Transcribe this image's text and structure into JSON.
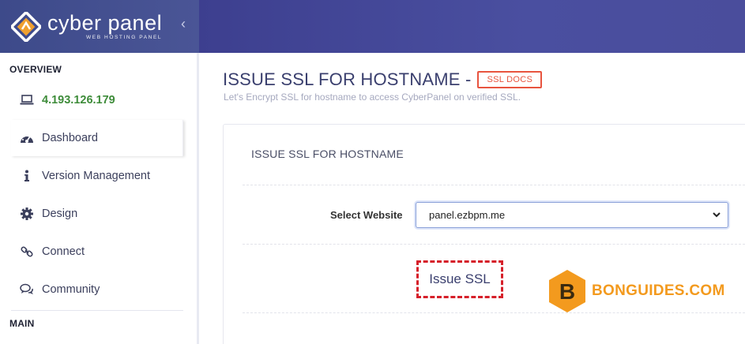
{
  "header": {
    "brand_name": "cyber panel",
    "brand_sub": "WEB HOSTING PANEL",
    "collapse_icon": "chevron-left-icon"
  },
  "sidebar": {
    "overview_label": "OVERVIEW",
    "main_label": "MAIN",
    "items": [
      {
        "label": "4.193.126.179",
        "icon": "laptop-icon"
      },
      {
        "label": "Dashboard",
        "icon": "dashboard-icon"
      },
      {
        "label": "Version Management",
        "icon": "info-icon"
      },
      {
        "label": "Design",
        "icon": "gear-icon"
      },
      {
        "label": "Connect",
        "icon": "link-icon"
      },
      {
        "label": "Community",
        "icon": "comments-icon"
      }
    ]
  },
  "main": {
    "title": "ISSUE SSL FOR HOSTNAME -",
    "docs_button": "SSL DOCS",
    "subtitle": "Let's Encrypt SSL for hostname to access CyberPanel on verified SSL.",
    "card_title": "ISSUE SSL FOR HOSTNAME",
    "select_label": "Select Website",
    "select_value": "panel.ezbpm.me",
    "issue_button": "Issue SSL"
  },
  "watermark": {
    "letter": "B",
    "text": "BONGUIDES.COM"
  },
  "colors": {
    "header": "#3d3f8f",
    "accent_red": "#e8543f",
    "ip_green": "#3e8c3a",
    "watermark_orange": "#f39a1e",
    "highlight_red": "#d6202a"
  }
}
